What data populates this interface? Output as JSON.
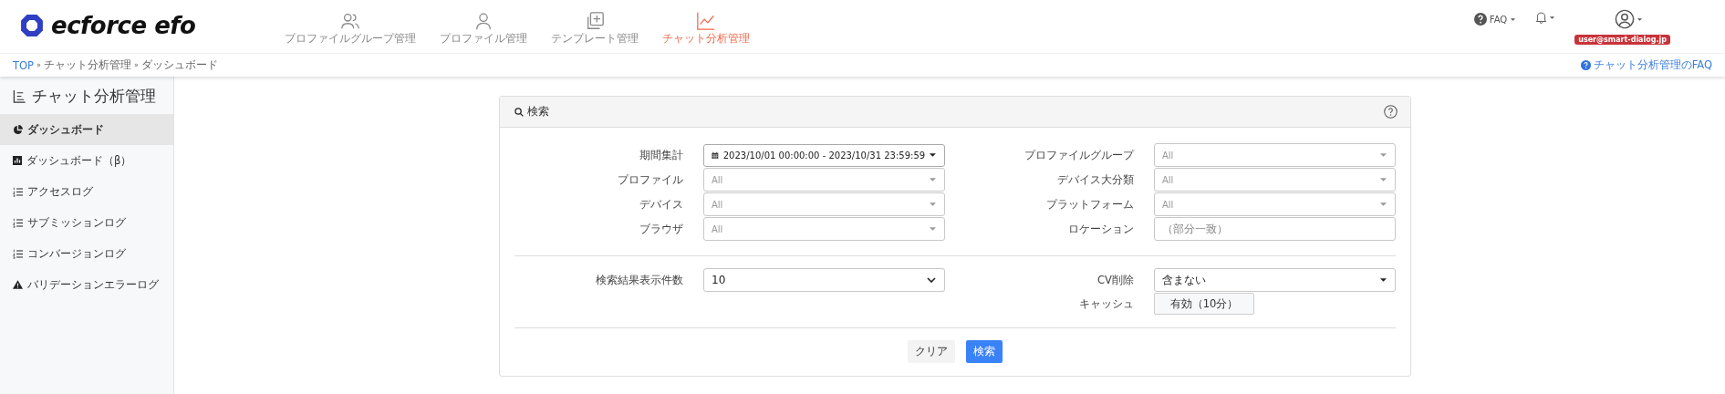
{
  "header": {
    "logo": "ecforce efo",
    "nav": [
      {
        "label": "プロファイルグループ管理",
        "kind": "users",
        "selected": false
      },
      {
        "label": "プロファイル管理",
        "kind": "user",
        "selected": false
      },
      {
        "label": "テンプレート管理",
        "kind": "copy",
        "selected": false
      },
      {
        "label": "チャット分析管理",
        "kind": "chart",
        "selected": true
      }
    ],
    "faq": "FAQ",
    "user_email": "user@smart-dialog.jp"
  },
  "breadcrumb": [
    {
      "text": "TOP",
      "kind": "link"
    },
    {
      "text": "»",
      "kind": "sep"
    },
    {
      "text": "チャット分析管理",
      "kind": "text"
    },
    {
      "text": "»",
      "kind": "sep"
    },
    {
      "text": "ダッシュボード",
      "kind": "text"
    }
  ],
  "help_link": "チャット分析管理のFAQ",
  "sidebar": {
    "title": "チャット分析管理",
    "items": [
      {
        "label": "ダッシュボード",
        "kind": "pie",
        "selected": true
      },
      {
        "label": "ダッシュボード（β）",
        "kind": "bar",
        "selected": false
      },
      {
        "label": "アクセスログ",
        "kind": "list",
        "selected": false
      },
      {
        "label": "サブミッションログ",
        "kind": "list",
        "selected": false
      },
      {
        "label": "コンバージョンログ",
        "kind": "list",
        "selected": false
      },
      {
        "label": "バリデーションエラーログ",
        "kind": "warning",
        "selected": false
      }
    ]
  },
  "search_panel": {
    "title": "検索",
    "sections": [
      {
        "left": [
          {
            "label": "期間集計",
            "kind": "date",
            "value": "2023/10/01 00:00:00 - 2023/10/31 23:59:59"
          },
          {
            "label": "プロファイル",
            "kind": "select",
            "placeholder": "All"
          },
          {
            "label": "デバイス",
            "kind": "select",
            "placeholder": "All"
          },
          {
            "label": "ブラウザ",
            "kind": "select",
            "placeholder": "All"
          }
        ],
        "right": [
          {
            "label": "プロファイルグループ",
            "kind": "select",
            "placeholder": "All"
          },
          {
            "label": "デバイス大分類",
            "kind": "select",
            "placeholder": "All"
          },
          {
            "label": "プラットフォーム",
            "kind": "select",
            "placeholder": "All"
          },
          {
            "label": "ロケーション",
            "kind": "text",
            "placeholder": "（部分一致）"
          }
        ]
      },
      {
        "left": [
          {
            "label": "検索結果表示件数",
            "kind": "native",
            "value": "10"
          }
        ],
        "right": [
          {
            "label": "CV削除",
            "kind": "select",
            "value": "含まない"
          },
          {
            "label": "キャッシュ",
            "kind": "button",
            "value": "有効（10分）"
          }
        ]
      }
    ],
    "buttons": [
      {
        "label": "クリア",
        "kind": "secondary"
      },
      {
        "label": "検索",
        "kind": "primary"
      }
    ]
  }
}
